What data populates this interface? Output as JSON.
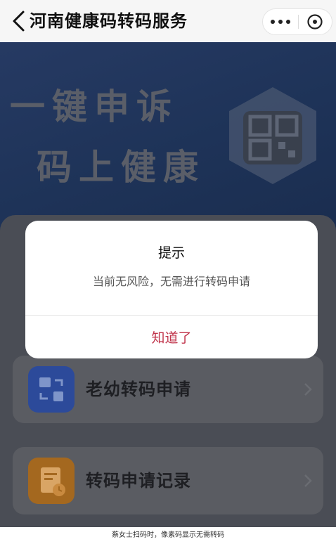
{
  "navbar": {
    "title": "河南健康码转码服务",
    "back_icon": "chevron-left-icon",
    "more_icon": "more-dots-icon",
    "close_icon": "circle-close-icon"
  },
  "banner": {
    "slogan_line_1": "一键申诉",
    "slogan_line_2": "码上健康",
    "badge_icon": "qr-code-icon"
  },
  "menu": {
    "items": [
      {
        "label": "老幼转码申请",
        "icon": "transfer-card-icon",
        "icon_color": "#2c4a9a"
      },
      {
        "label": "转码申请记录",
        "icon": "record-document-icon",
        "icon_color": "#a4681f"
      }
    ]
  },
  "dialog": {
    "title": "提示",
    "message": "当前无风险，无需进行转码申请",
    "confirm_label": "知道了",
    "confirm_color": "#c0344b"
  },
  "caption": "蔡女士扫码时，像素码显示无需转码"
}
